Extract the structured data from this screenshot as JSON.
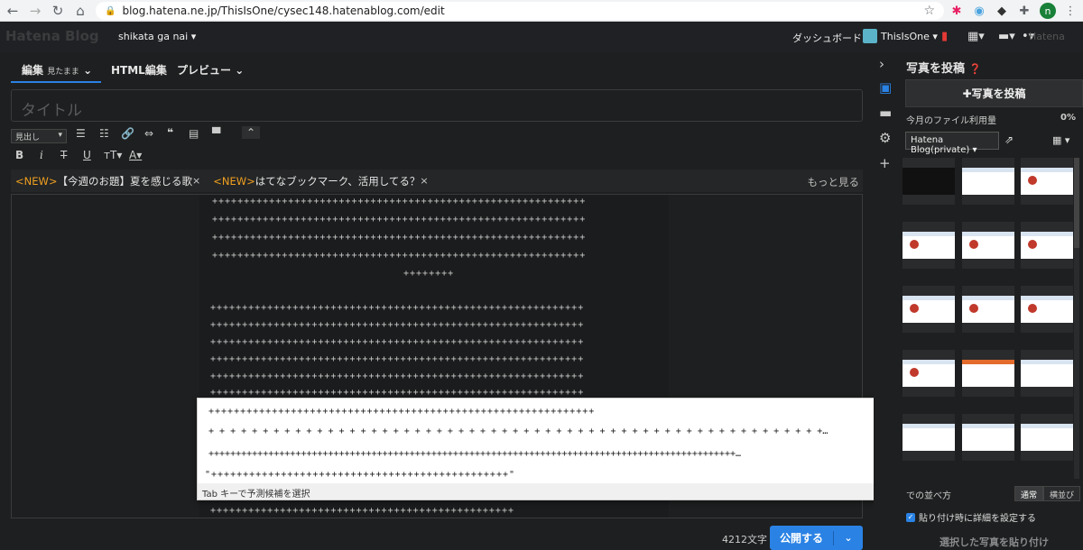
{
  "browser": {
    "url": "blog.hatena.ne.jp/ThisIsOne/cysec148.hatenablog.com/edit",
    "profile_initial": "n"
  },
  "header": {
    "logo": "Hatena Blog",
    "blog_name": "shikata ga nai ▾",
    "dashboard": "ダッシュボード",
    "user": "ThisIsOne ▾",
    "brand": "Hatena"
  },
  "editor": {
    "tab_edit": "編集",
    "tab_edit_mode": "見たまま",
    "tab_html": "HTML編集",
    "tab_preview": "プレビュー",
    "title_placeholder": "タイトル",
    "style_select": "見出し",
    "notices": [
      {
        "tag": "<NEW>",
        "text": "【今週のお題】夏を感じる歌"
      },
      {
        "tag": "<NEW>",
        "text": "はてなブックマーク、活用してる？"
      }
    ],
    "more": "もっと見る",
    "lines": [
      "+++++++++++++++++++++++++++++++++++++++++++++++++++++++++++",
      "+++++++++++++++++++++++++++++++++++++++++++++++++++++++++++",
      "+++++++++++++++++++++++++++++++++++++++++++++++++++++++++++",
      "+++++++++++++++++++++++++++++++++++++++++++++++++++++++++++",
      "++++++++",
      "+++++++++++++++++++++++++++++++++++++++++++++++++++++++++++",
      "+++++++++++++++++++++++++++++++++++++++++++++++++++++++++++",
      "+++++++++++++++++++++++++++++++++++++++++++++++++++++++++++",
      "+++++++++++++++++++++++++++++++++++++++++++++++++++++++++++",
      "+++++++++++++++++++++++++++++++++++++++++++++++++++++++++++",
      "+++++++++++++++++++++++++++++++++++++++++++++++++++++++++++",
      "++++++++++++++++++++++++++++++++++++++++++++++++"
    ],
    "ime_candidates": [
      "+++++++++++++++++++++++++++++++++++++++++++++++++++++++++++++",
      "+ + + + + + + + + + + + + + + + + + + + + + + + + + + + + + + + + + + + + + + + + + + + + + + + + + + + + + + + +…",
      "+++++++++++++++++++++++++++++++++++++++++++++++++++++++++++++++++++++++++++++++++++++++++++++++++…",
      "\"+++++++++++++++++++++++++++++++++++++++++++++++\""
    ],
    "ime_footer": "Tab キーで予測候補を選択",
    "char_count": "4212文字",
    "publish": "公開する"
  },
  "photo_panel": {
    "title": "写真を投稿",
    "post_button": "写真を投稿",
    "usage_label": "今月のファイル利用量",
    "usage_value": "0%",
    "blog_dropdown": "Hatena Blog(private) ▾",
    "sort_label": "での並べ方",
    "sort_normal": "通常",
    "sort_horizontal": "横並び",
    "detail_checkbox": "貼り付け時に詳細を設定する",
    "paste_button": "選択した写真を貼り付け"
  }
}
